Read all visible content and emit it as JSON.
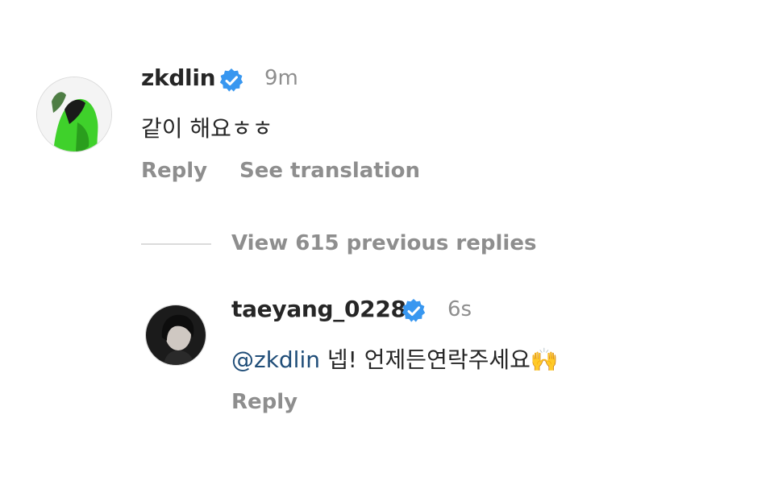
{
  "comment": {
    "username": "zkdlin",
    "time": "9m",
    "text": "같이 해요ㅎㅎ",
    "reply_label": "Reply",
    "translate_label": "See translation",
    "avatar_icon": "avatar-green-figure",
    "verified_icon": "verified-badge-icon"
  },
  "thread": {
    "view_replies_label": "View 615 previous replies"
  },
  "reply": {
    "username": "taeyang_0228",
    "time": "6s",
    "mention": "@zkdlin",
    "text": "넵! 언제든연락주세요",
    "emoji": "🙌",
    "reply_label": "Reply",
    "avatar_icon": "avatar-dark-portrait",
    "verified_icon": "verified-badge-icon"
  },
  "colors": {
    "verified_blue": "#3897f0",
    "secondary_text": "#8e8e8e",
    "mention": "#1f4d78"
  }
}
